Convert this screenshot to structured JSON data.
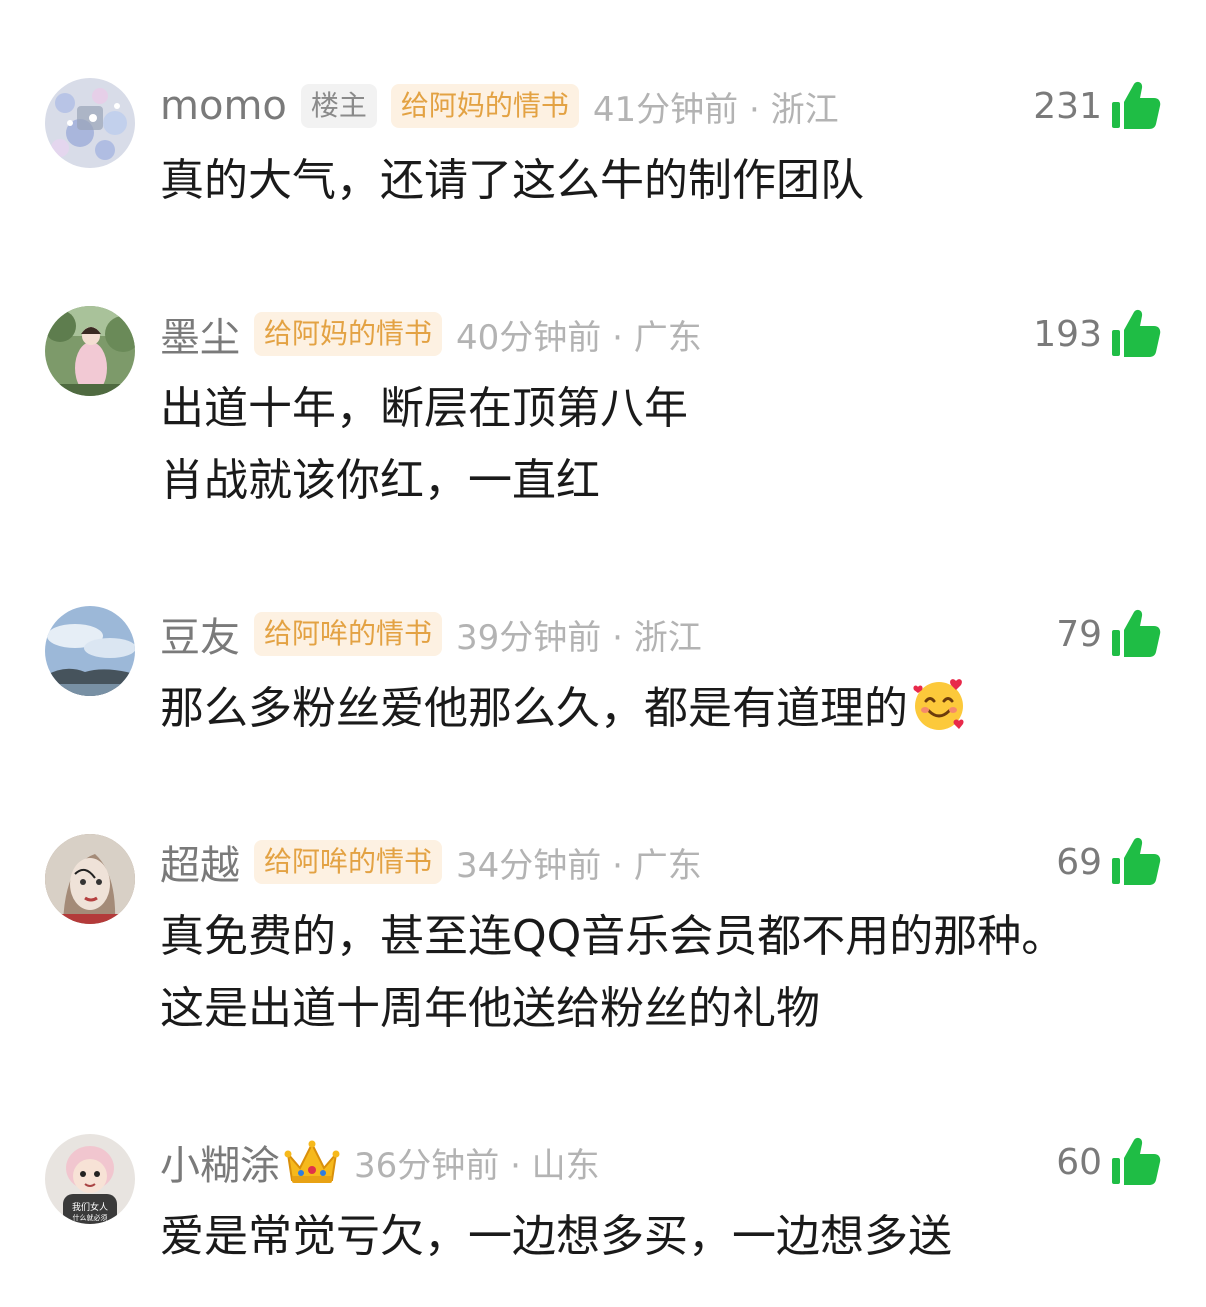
{
  "comments": [
    {
      "name": "momo",
      "owner_tag": "楼主",
      "badge": "给阿妈的情书",
      "time": "41分钟前 · 浙江",
      "likes": "231",
      "lines": [
        "真的大气，还请了这么牛的制作团队"
      ]
    },
    {
      "name": "墨尘",
      "badge": "给阿妈的情书",
      "time": "40分钟前 · 广东",
      "likes": "193",
      "lines": [
        "出道十年，断层在顶第八年",
        "肖战就该你红，一直红"
      ]
    },
    {
      "name": "豆友",
      "badge": "给阿哞的情书",
      "time": "39分钟前 · 浙江",
      "likes": "79",
      "lines": [
        "那么多粉丝爱他那么久，都是有道理的"
      ],
      "emoji": "smiling-face-with-hearts-emoji"
    },
    {
      "name": "超越",
      "badge": "给阿哞的情书",
      "time": "34分钟前 · 广东",
      "likes": "69",
      "lines": [
        "真免费的，甚至连QQ音乐会员都不用的那种。",
        "这是出道十周年他送给粉丝的礼物"
      ]
    },
    {
      "name": "小糊涂",
      "crown": "crown-icon",
      "avatar_text": [
        "我们女人",
        "什么就必须"
      ],
      "time": "36分钟前 · 山东",
      "likes": "60",
      "lines": [
        "爱是常觉亏欠，一边想多买，一边想多送"
      ]
    }
  ],
  "colors": {
    "like_green": "#1fbd45",
    "badge_bg": "#fdf1e2",
    "badge_text": "#e3a243",
    "meta_gray": "#b3b3b3",
    "name_gray": "#7a7a7a"
  }
}
